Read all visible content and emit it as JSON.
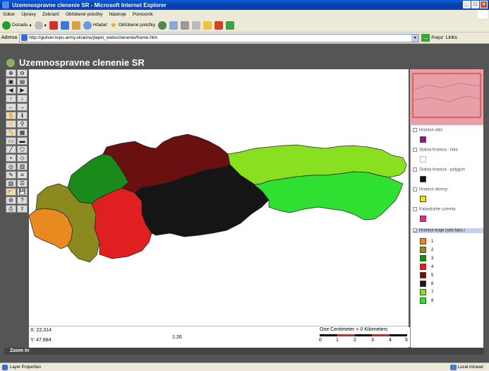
{
  "window": {
    "title": "Uzemnospravne clenenie SR - Microsoft Internet Explorer"
  },
  "menu": [
    "Súbor",
    "Úpravy",
    "Zobraziť",
    "Obľúbené položky",
    "Nástroje",
    "Pomocník"
  ],
  "toolbar": {
    "back": "Dozadu",
    "search": "Hľadať",
    "favorites": "Obľúbené položky"
  },
  "address": {
    "label": "Adresa",
    "url": "http://guliver.topu.army.sk/aims/jlapin_webs/clenenie/frame.htm",
    "go": "Prejsť",
    "links": "Links"
  },
  "app": {
    "title": "Uzemnospravne clenenie SR"
  },
  "coords": {
    "x": "X: 22,314",
    "y": "Y: 47,884",
    "scale": "1:26"
  },
  "scalebar": {
    "label": "One Centimeter = 0 Kilometers",
    "ticks": [
      "0",
      "1",
      "2",
      "3",
      "4",
      "5"
    ]
  },
  "legend": {
    "layers": [
      {
        "label": "Hranice obci",
        "color": "#8b1a8b",
        "checked": false
      },
      {
        "label": "Statna hranica - linia",
        "color": "#80d0e0",
        "checked": false
      },
      {
        "label": "Statna hranica - polygon",
        "color": "#111111",
        "checked": false
      },
      {
        "label": "Hranice okresy",
        "color": "#e8e020",
        "checked": false
      },
      {
        "label": "Katastralne uzemia",
        "color": "#e03090",
        "checked": false
      },
      {
        "label": "Hranice kraje (sde.fako.i",
        "color": "",
        "checked": true
      }
    ],
    "classes": [
      {
        "label": "1",
        "color": "#e88a20"
      },
      {
        "label": "2",
        "color": "#8a8a20"
      },
      {
        "label": "3",
        "color": "#1a8a1a"
      },
      {
        "label": "4",
        "color": "#e02020"
      },
      {
        "label": "5",
        "color": "#6a1010"
      },
      {
        "label": "6",
        "color": "#151515"
      },
      {
        "label": "7",
        "color": "#88e020"
      },
      {
        "label": "8",
        "color": "#30e030"
      }
    ]
  },
  "status": {
    "mode": "Zoom In",
    "left": "Layer Properties",
    "zone": "Local intranet"
  }
}
